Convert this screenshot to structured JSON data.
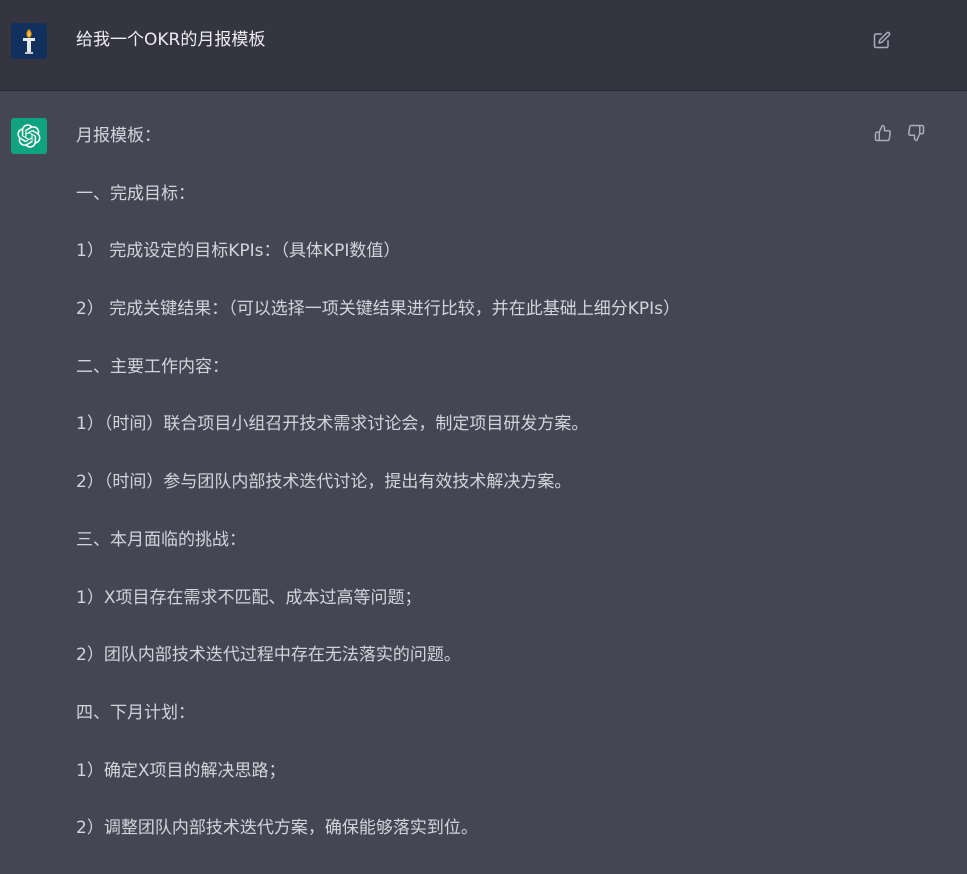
{
  "user_message": {
    "text": "给我一个OKR的月报模板",
    "avatar_icon": "torch-avatar-icon",
    "edit_icon": "edit-icon"
  },
  "assistant_message": {
    "avatar_icon": "openai-logo-icon",
    "lines": [
      "月报模板：",
      "一、完成目标：",
      "1） 完成设定的目标KPIs：（具体KPI数值）",
      "2） 完成关键结果：（可以选择一项关键结果进行比较，并在此基础上细分KPIs）",
      "二、主要工作内容：",
      "1）（时间）联合项目小组召开技术需求讨论会，制定项目研发方案。",
      "2）（时间）参与团队内部技术迭代讨论，提出有效技术解决方案。",
      "三、本月面临的挑战：",
      "1）X项目存在需求不匹配、成本过高等问题；",
      "2）团队内部技术迭代过程中存在无法落实的问题。",
      "四、下月计划：",
      "1）确定X项目的解决思路；",
      "2）调整团队内部技术迭代方案，确保能够落实到位。"
    ],
    "feedback": {
      "thumbs_up_icon": "thumbs-up-icon",
      "thumbs_down_icon": "thumbs-down-icon"
    }
  },
  "colors": {
    "user_bg": "#343541",
    "assistant_bg": "#444654",
    "gpt_green": "#10a37f",
    "text": "#d1d5db"
  }
}
